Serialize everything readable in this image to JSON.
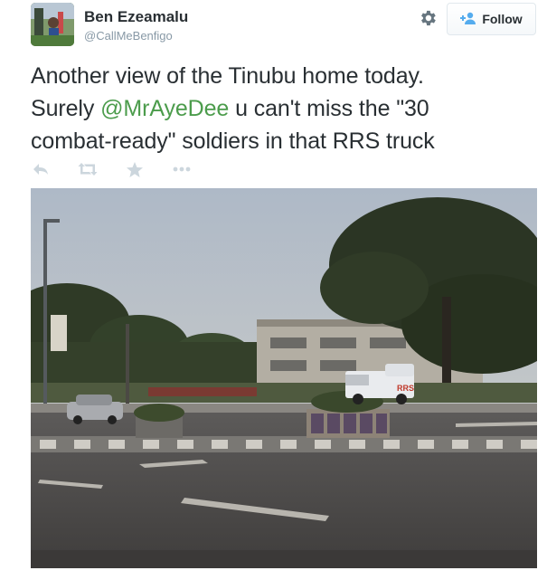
{
  "tweet": {
    "author_name": "Ben Ezeamalu",
    "author_handle": "@CallMeBenfigo",
    "text_line1": "Another view of the Tinubu home today.",
    "text_line2_prefix": "Surely ",
    "mention": "@MrAyeDee",
    "text_line2_suffix": " u can't miss the \"30",
    "text_line3": "combat-ready\" soldiers in that RRS truck",
    "truck_marking": "RRS"
  },
  "header": {
    "follow_label": "Follow"
  },
  "actions": [
    "reply-icon",
    "retweet-icon",
    "favorite-icon",
    "more-icon"
  ],
  "colors": {
    "mention": "#4c9c4c",
    "name": "#292f33",
    "handle": "#8899a6",
    "icon": "#ccd6dd"
  }
}
